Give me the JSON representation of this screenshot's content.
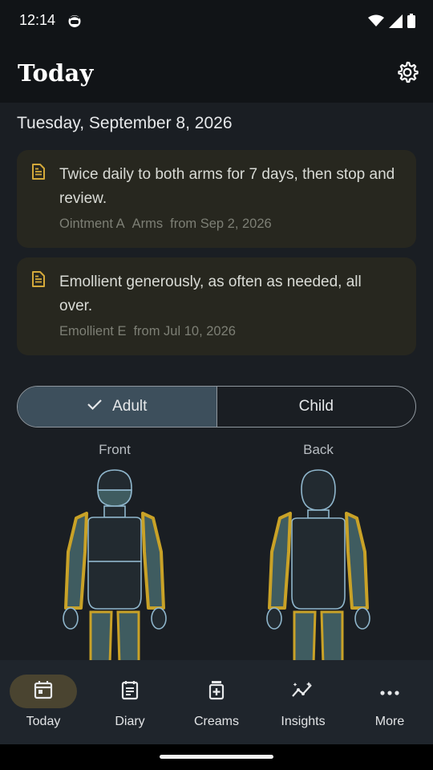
{
  "status_bar": {
    "time": "12:14",
    "icons": [
      "notification-face-icon",
      "wifi-icon",
      "signal-icon",
      "battery-icon"
    ]
  },
  "app_bar": {
    "title": "Today",
    "settings_icon": "gear-icon"
  },
  "date": "Tuesday, September 8, 2026",
  "notes": [
    {
      "icon": "document-icon",
      "text": "Twice daily to both arms for 7 days, then stop and review.",
      "product": "Ointment A",
      "area": "Arms",
      "from": "from Sep 2, 2026"
    },
    {
      "icon": "document-icon",
      "text": "Emollient generously, as often as needed, all over.",
      "product": "Emollient E",
      "from": "from Jul 10, 2026"
    }
  ],
  "body_type_toggle": {
    "options": [
      "Adult",
      "Child"
    ],
    "selected": "Adult"
  },
  "body_map": {
    "front_label": "Front",
    "back_label": "Back",
    "highlight_color": "#c9a227",
    "outline_color": "#8fb6cc",
    "filled_color": "#3f5c60"
  },
  "bottom_nav": {
    "items": [
      {
        "label": "Today",
        "icon": "calendar-icon",
        "active": true
      },
      {
        "label": "Diary",
        "icon": "diary-icon",
        "active": false
      },
      {
        "label": "Creams",
        "icon": "cream-jar-icon",
        "active": false
      },
      {
        "label": "Insights",
        "icon": "insights-icon",
        "active": false
      },
      {
        "label": "More",
        "icon": "more-dots-icon",
        "active": false
      }
    ]
  },
  "colors": {
    "background": "#1a1e23",
    "card": "#27271f",
    "accent": "#d4a93a",
    "active_pill": "#4a4430",
    "segment_selected": "#3d4f5c"
  }
}
